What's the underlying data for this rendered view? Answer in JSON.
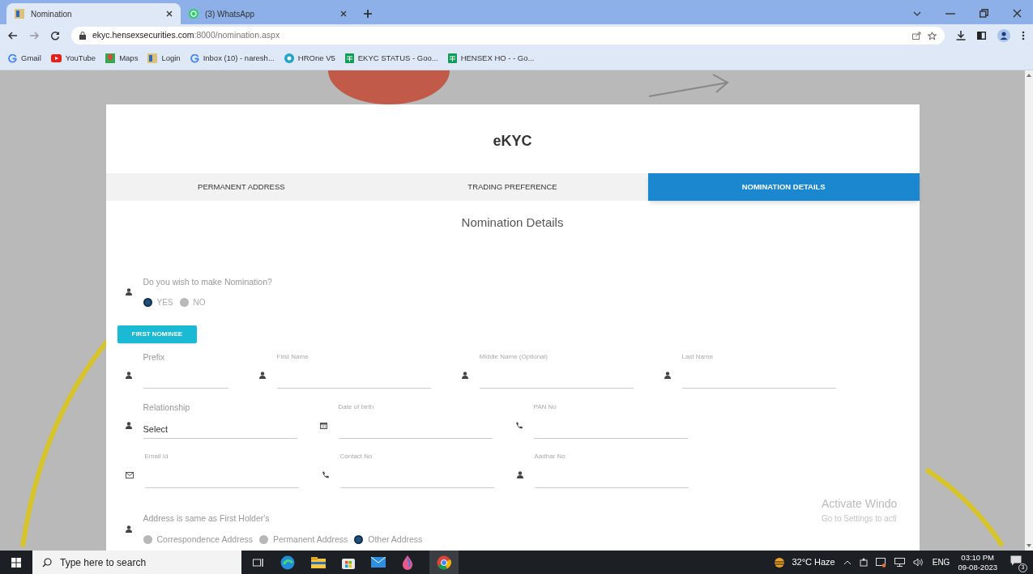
{
  "browser": {
    "tabs": [
      {
        "title": "Nomination",
        "kind": "site",
        "selected": true
      },
      {
        "title": "(3) WhatsApp",
        "kind": "whatsapp",
        "selected": false
      }
    ],
    "url": "ekyc.hensexsecurities.com",
    "url_rest": ":8000/nomination.aspx",
    "bookmarks": [
      {
        "label": "Gmail",
        "kind": "google"
      },
      {
        "label": "YouTube",
        "kind": "youtube"
      },
      {
        "label": "Maps",
        "kind": "maps"
      },
      {
        "label": "Login",
        "kind": "site"
      },
      {
        "label": "Inbox (10) - naresh...",
        "kind": "google"
      },
      {
        "label": "HROne V5",
        "kind": "hrone"
      },
      {
        "label": "EKYC STATUS - Goo...",
        "kind": "sheets"
      },
      {
        "label": "HENSEX HO - - Go...",
        "kind": "sheets"
      }
    ]
  },
  "form": {
    "title": "eKYC",
    "steps": [
      {
        "label": "PERMANENT ADDRESS",
        "selected": false
      },
      {
        "label": "TRADING PREFERENCE",
        "selected": false
      },
      {
        "label": "NOMINATION DETAILS",
        "selected": true
      }
    ],
    "section_title": "Nomination Details",
    "nomination_question": "Do you wish to make Nomination?",
    "nomination_options": [
      {
        "label": "YES",
        "selected": true
      },
      {
        "label": "NO",
        "selected": false
      }
    ],
    "nominee_button": "FIRST NOMINEE",
    "field_rows": [
      [
        {
          "label": "Prefix"
        },
        {
          "label": "First Name"
        },
        {
          "label": "Middle Name (Optional)"
        },
        {
          "label": "Last Name"
        }
      ],
      [
        {
          "label": "Relationship",
          "value": "Select"
        },
        {
          "label": "Date of birth"
        },
        {
          "label": "PAN No"
        }
      ],
      [
        {
          "label": "Email Id"
        },
        {
          "label": "Contact No"
        },
        {
          "label": "Aadhar No"
        }
      ]
    ],
    "address_question": "Address is same as First Holder's",
    "address_options": [
      {
        "label": "Correspondence Address",
        "selected": false
      },
      {
        "label": "Permanent Address",
        "selected": false
      },
      {
        "label": "Other Address",
        "selected": true
      }
    ]
  },
  "activation_notice": {
    "title": "Activate Windo",
    "subtitle": "Go to Settings to acti"
  },
  "taskbar": {
    "search_placeholder": "Type here to search",
    "weather": "32°C  Haze",
    "language": "ENG",
    "time": "03:10 PM",
    "date": "09-08-2023",
    "notifications": "3"
  }
}
